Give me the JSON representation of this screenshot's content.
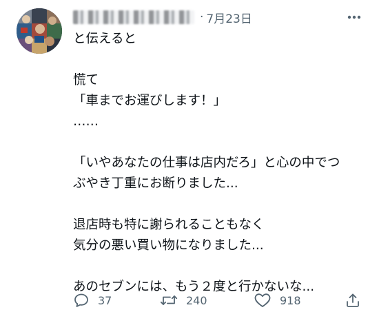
{
  "tweet": {
    "date": "7月23日",
    "separator": "·",
    "lines": [
      "と伝えると",
      "",
      "慌て",
      "「車までお運びします！」",
      "……",
      "",
      "「いやあなたの仕事は店内だろ」と心の中でつ",
      "ぶやき丁重にお断りました...",
      "",
      "退店時も特に謝られることもなく",
      "気分の悪い買い物になりました...",
      "",
      "あのセブンには、もう２度と行かないな..."
    ]
  },
  "actions": {
    "reply_count": "37",
    "retweet_count": "240",
    "like_count": "918"
  },
  "icons": {
    "more": "more-icon",
    "reply": "reply-icon",
    "retweet": "retweet-icon",
    "like": "heart-icon",
    "share": "share-icon"
  },
  "colors": {
    "text": "#0f1419",
    "secondary": "#536471"
  }
}
